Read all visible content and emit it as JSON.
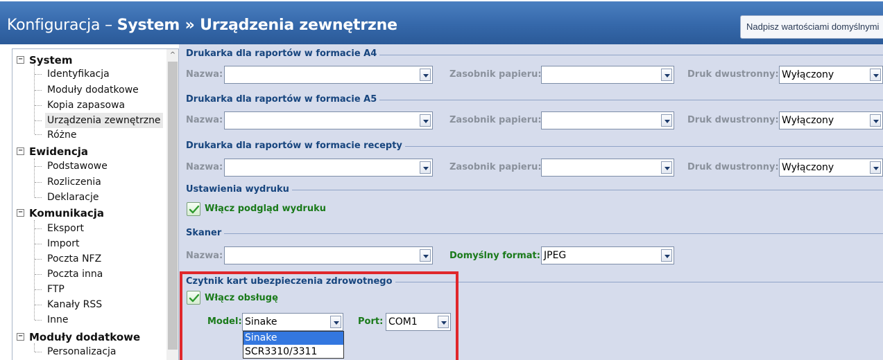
{
  "window": {
    "title_prefix": "Konfiguracja – ",
    "title_bold": "System » Urządzenia zewnętrzne",
    "defaults_button": "Nadpisz wartościami domyślnymi"
  },
  "tree": {
    "groups": [
      {
        "label": "System",
        "expander": "−",
        "items": [
          "Identyfikacja",
          "Moduły dodatkowe",
          "Kopia zapasowa",
          "Urządzenia zewnętrzne",
          "Różne"
        ]
      },
      {
        "label": "Ewidencja",
        "expander": "−",
        "items": [
          "Podstawowe",
          "Rozliczenia",
          "Deklaracje"
        ]
      },
      {
        "label": "Komunikacja",
        "expander": "−",
        "items": [
          "Eksport",
          "Import",
          "Poczta NFZ",
          "Poczta inna",
          "FTP",
          "Kanały RSS",
          "Inne"
        ]
      },
      {
        "label": "Moduły dodatkowe",
        "expander": "−",
        "items": [
          "Personalizacja"
        ]
      }
    ],
    "selected": "Urządzenia zewnętrzne"
  },
  "printers": [
    {
      "title": "Drukarka dla raportów w formacie A4",
      "name_label": "Nazwa:",
      "name_value": "",
      "tray_label": "Zasobnik papieru:",
      "tray_value": "",
      "duplex_label": "Druk dwustronny:",
      "duplex_value": "Wyłączony"
    },
    {
      "title": "Drukarka dla raportów w formacie A5",
      "name_label": "Nazwa:",
      "name_value": "",
      "tray_label": "Zasobnik papieru:",
      "tray_value": "",
      "duplex_label": "Druk dwustronny:",
      "duplex_value": "Wyłączony"
    },
    {
      "title": "Drukarka dla raportów w formacie recepty",
      "name_label": "Nazwa:",
      "name_value": "",
      "tray_label": "Zasobnik papieru:",
      "tray_value": "",
      "duplex_label": "Druk dwustronny:",
      "duplex_value": "Wyłączony"
    }
  ],
  "print_settings": {
    "title": "Ustawienia wydruku",
    "preview_label": "Włącz podgląd wydruku",
    "preview_checked": true
  },
  "scanner": {
    "title": "Skaner",
    "name_label": "Nazwa:",
    "name_value": "",
    "format_label": "Domyślny format:",
    "format_value": "JPEG"
  },
  "card_reader": {
    "title": "Czytnik kart ubezpieczenia zdrowotnego",
    "enable_label": "Włącz obsługę",
    "enable_checked": true,
    "model_label": "Model:",
    "model_value": "Sinake",
    "port_label": "Port:",
    "port_value": "COM1",
    "model_options": [
      "Sinake",
      "SCR3310/3311"
    ],
    "model_selected_option": "Sinake"
  },
  "colors": {
    "titlebar": "#3568aa",
    "section_title": "#17457e",
    "green_label": "#1a7a1a",
    "highlight": "#e0272b",
    "dropdown_selection": "#3377e0"
  }
}
